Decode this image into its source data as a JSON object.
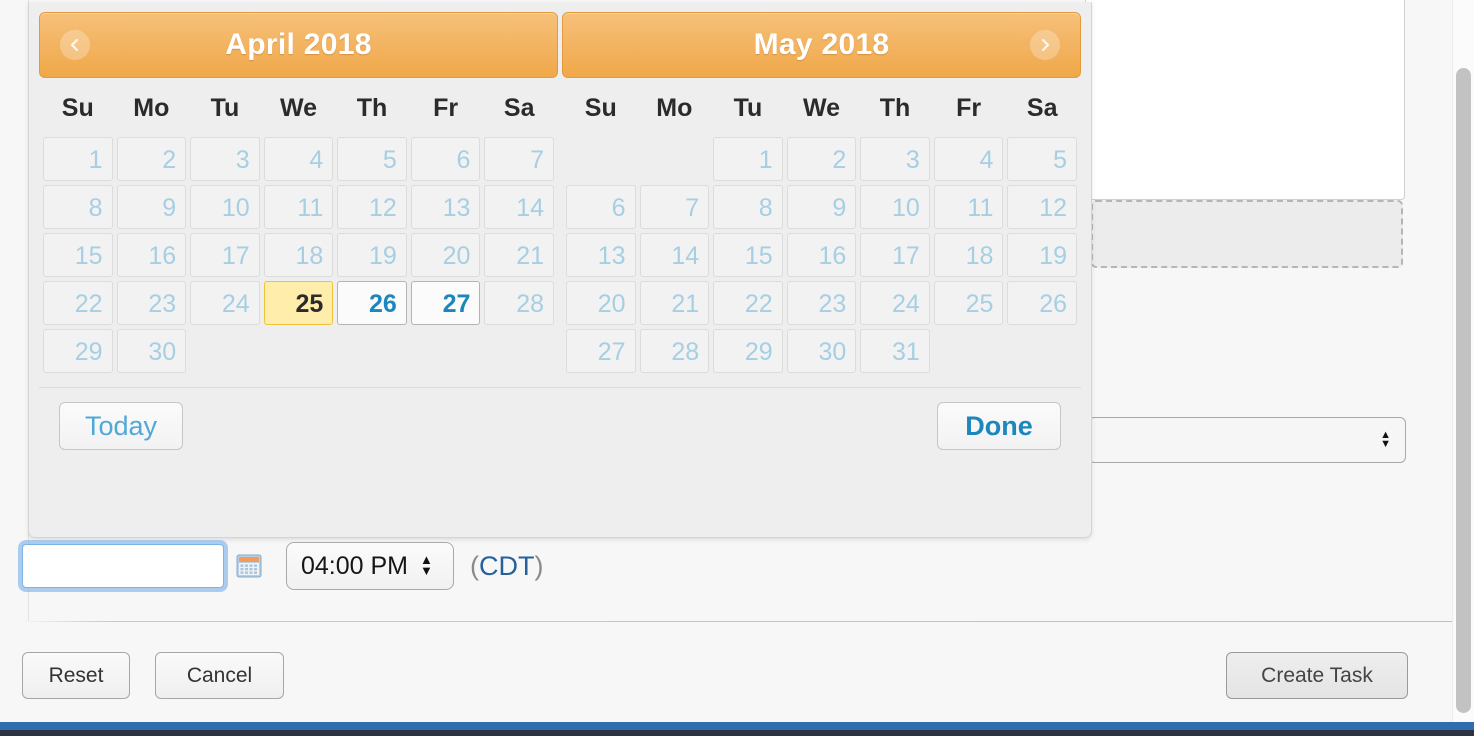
{
  "datepicker": {
    "prev_icon": "chevron-left-icon",
    "next_icon": "chevron-right-icon",
    "weekdays": [
      "Su",
      "Mo",
      "Tu",
      "We",
      "Th",
      "Fr",
      "Sa"
    ],
    "today_label": "Today",
    "done_label": "Done",
    "months": [
      {
        "title": "April 2018",
        "weeks": [
          [
            {
              "d": "1",
              "state": "disabled"
            },
            {
              "d": "2",
              "state": "disabled"
            },
            {
              "d": "3",
              "state": "disabled"
            },
            {
              "d": "4",
              "state": "disabled"
            },
            {
              "d": "5",
              "state": "disabled"
            },
            {
              "d": "6",
              "state": "disabled"
            },
            {
              "d": "7",
              "state": "disabled"
            }
          ],
          [
            {
              "d": "8",
              "state": "disabled"
            },
            {
              "d": "9",
              "state": "disabled"
            },
            {
              "d": "10",
              "state": "disabled"
            },
            {
              "d": "11",
              "state": "disabled"
            },
            {
              "d": "12",
              "state": "disabled"
            },
            {
              "d": "13",
              "state": "disabled"
            },
            {
              "d": "14",
              "state": "disabled"
            }
          ],
          [
            {
              "d": "15",
              "state": "disabled"
            },
            {
              "d": "16",
              "state": "disabled"
            },
            {
              "d": "17",
              "state": "disabled"
            },
            {
              "d": "18",
              "state": "disabled"
            },
            {
              "d": "19",
              "state": "disabled"
            },
            {
              "d": "20",
              "state": "disabled"
            },
            {
              "d": "21",
              "state": "disabled"
            }
          ],
          [
            {
              "d": "22",
              "state": "disabled"
            },
            {
              "d": "23",
              "state": "disabled"
            },
            {
              "d": "24",
              "state": "disabled"
            },
            {
              "d": "25",
              "state": "today"
            },
            {
              "d": "26",
              "state": "enabled"
            },
            {
              "d": "27",
              "state": "enabled"
            },
            {
              "d": "28",
              "state": "disabled"
            }
          ],
          [
            {
              "d": "29",
              "state": "disabled"
            },
            {
              "d": "30",
              "state": "disabled"
            },
            {
              "d": "",
              "state": "empty"
            },
            {
              "d": "",
              "state": "empty"
            },
            {
              "d": "",
              "state": "empty"
            },
            {
              "d": "",
              "state": "empty"
            },
            {
              "d": "",
              "state": "empty"
            }
          ]
        ]
      },
      {
        "title": "May 2018",
        "weeks": [
          [
            {
              "d": "",
              "state": "empty"
            },
            {
              "d": "",
              "state": "empty"
            },
            {
              "d": "1",
              "state": "disabled"
            },
            {
              "d": "2",
              "state": "disabled"
            },
            {
              "d": "3",
              "state": "disabled"
            },
            {
              "d": "4",
              "state": "disabled"
            },
            {
              "d": "5",
              "state": "disabled"
            }
          ],
          [
            {
              "d": "6",
              "state": "disabled"
            },
            {
              "d": "7",
              "state": "disabled"
            },
            {
              "d": "8",
              "state": "disabled"
            },
            {
              "d": "9",
              "state": "disabled"
            },
            {
              "d": "10",
              "state": "disabled"
            },
            {
              "d": "11",
              "state": "disabled"
            },
            {
              "d": "12",
              "state": "disabled"
            }
          ],
          [
            {
              "d": "13",
              "state": "disabled"
            },
            {
              "d": "14",
              "state": "disabled"
            },
            {
              "d": "15",
              "state": "disabled"
            },
            {
              "d": "16",
              "state": "disabled"
            },
            {
              "d": "17",
              "state": "disabled"
            },
            {
              "d": "18",
              "state": "disabled"
            },
            {
              "d": "19",
              "state": "disabled"
            }
          ],
          [
            {
              "d": "20",
              "state": "disabled"
            },
            {
              "d": "21",
              "state": "disabled"
            },
            {
              "d": "22",
              "state": "disabled"
            },
            {
              "d": "23",
              "state": "disabled"
            },
            {
              "d": "24",
              "state": "disabled"
            },
            {
              "d": "25",
              "state": "disabled"
            },
            {
              "d": "26",
              "state": "disabled"
            }
          ],
          [
            {
              "d": "27",
              "state": "disabled"
            },
            {
              "d": "28",
              "state": "disabled"
            },
            {
              "d": "29",
              "state": "disabled"
            },
            {
              "d": "30",
              "state": "disabled"
            },
            {
              "d": "31",
              "state": "disabled"
            },
            {
              "d": "",
              "state": "empty"
            },
            {
              "d": "",
              "state": "empty"
            }
          ]
        ]
      }
    ]
  },
  "datetime_row": {
    "date_input_value": "",
    "date_input_placeholder": "",
    "calendar_icon": "calendar-icon",
    "time_value": "04:00 PM",
    "timezone_open": "(",
    "timezone_label": "CDT",
    "timezone_close": ")"
  },
  "background_form": {
    "select_value": ""
  },
  "actions": {
    "reset_label": "Reset",
    "cancel_label": "Cancel",
    "create_label": "Create Task"
  },
  "colors": {
    "header_orange_top": "#f6c07a",
    "header_orange_bottom": "#f0a849",
    "today_bg": "#ffeeab",
    "today_border": "#f0c33c",
    "enabled_day_text": "#1b87bd",
    "disabled_day_text": "#a6cfe3",
    "link_blue": "#26619c",
    "focus_ring": "#7eb3e4",
    "bottom_bar_blue": "#2f6daf"
  }
}
